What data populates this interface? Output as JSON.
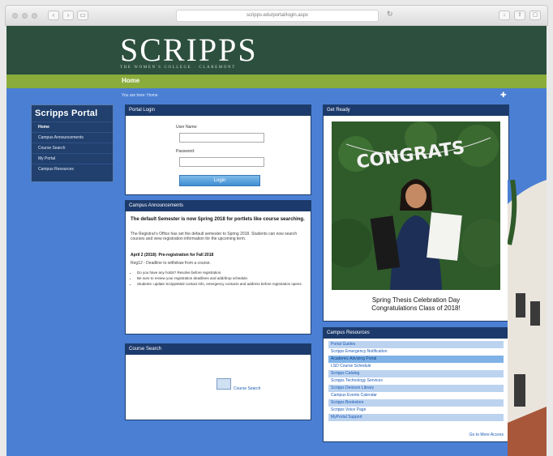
{
  "browser": {
    "url": "scripps.edu/portal/login.aspx",
    "reload_icon": "reload-icon"
  },
  "site": {
    "logo_word": "SCRIPPS",
    "logo_sub": "THE WOMEN'S COLLEGE · CLAREMONT",
    "nav_home": "Home",
    "breadcrumb": "You are here: Home"
  },
  "sidebar": {
    "title": "Scripps Portal",
    "items": [
      "Home",
      "Campus Announcements",
      "Course Search",
      "My Portal",
      "Campus Resources"
    ]
  },
  "login": {
    "header": "Portal Login",
    "user_label": "User Name:",
    "pass_label": "Password:",
    "button": "Login"
  },
  "announcements": {
    "header": "Campus Announcements",
    "title": "The default Semester is now Spring 2018 for portlets like course searching.",
    "body1": "The Registrar's Office has set the default semester to Spring 2018. Students can now search courses and view registration information for the upcoming term.",
    "subtitle": "April 2 (2018): Pre-registration for Fall 2018",
    "body2": "Reg12 - Deadline to withdraw from a course.",
    "bullets": [
      "Do you have any holds? Resolve before registration.",
      "Be sure to review your registration deadlines and add/drop schedule.",
      "Students: update ScrippsMail contact info, emergency contacts and address before registration opens."
    ]
  },
  "get_ready": {
    "header": "Get Ready",
    "banner_text": "CONGRATS",
    "caption_line1": "Spring Thesis Celebration Day",
    "caption_line2": "Congratulations Class of 2018!"
  },
  "resources": {
    "header": "Campus Resources",
    "items": [
      "Portal Guides",
      "Scripps Emergency Notification",
      "Academic Advising Portal",
      "LSD Course Schedule",
      "Scripps Catalog",
      "Scripps Technology Services",
      "Scripps Denison Library",
      "Campus Events Calendar",
      "Scripps Bookstore",
      "Scripps Voice Page",
      "MyPortal Support"
    ],
    "more_link": "Go to More Access"
  },
  "find_course": {
    "header": "Course Search",
    "link": "Course Search"
  },
  "colors": {
    "page_bg": "#4a7fd4",
    "banner": "#2c4f3e",
    "accent_green": "#8aac3b",
    "panel_header": "#1c3a6b"
  }
}
